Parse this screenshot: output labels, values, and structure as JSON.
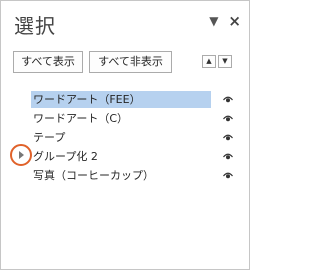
{
  "pane": {
    "title": "選択",
    "menu_icon": "dropdown-triangle-icon",
    "close_label": "×"
  },
  "toolbar": {
    "show_all": "すべて表示",
    "hide_all": "すべて非表示",
    "move_up": "▲",
    "move_down": "▼"
  },
  "items": [
    {
      "label": "ワードアート（FEE）",
      "selected": true,
      "icon": "eye-icon"
    },
    {
      "label": "ワードアート（C）",
      "selected": false,
      "icon": "eye-icon"
    },
    {
      "label": "テープ",
      "selected": false,
      "icon": "eye-icon"
    },
    {
      "label": "グループ化 2",
      "selected": false,
      "icon": "eye-icon",
      "collapsed": true
    },
    {
      "label": "写真（コーヒーカップ）",
      "selected": false,
      "icon": "eye-icon"
    }
  ],
  "colors": {
    "selection": "#b6d1ef",
    "highlight_circle": "#e0622a"
  }
}
